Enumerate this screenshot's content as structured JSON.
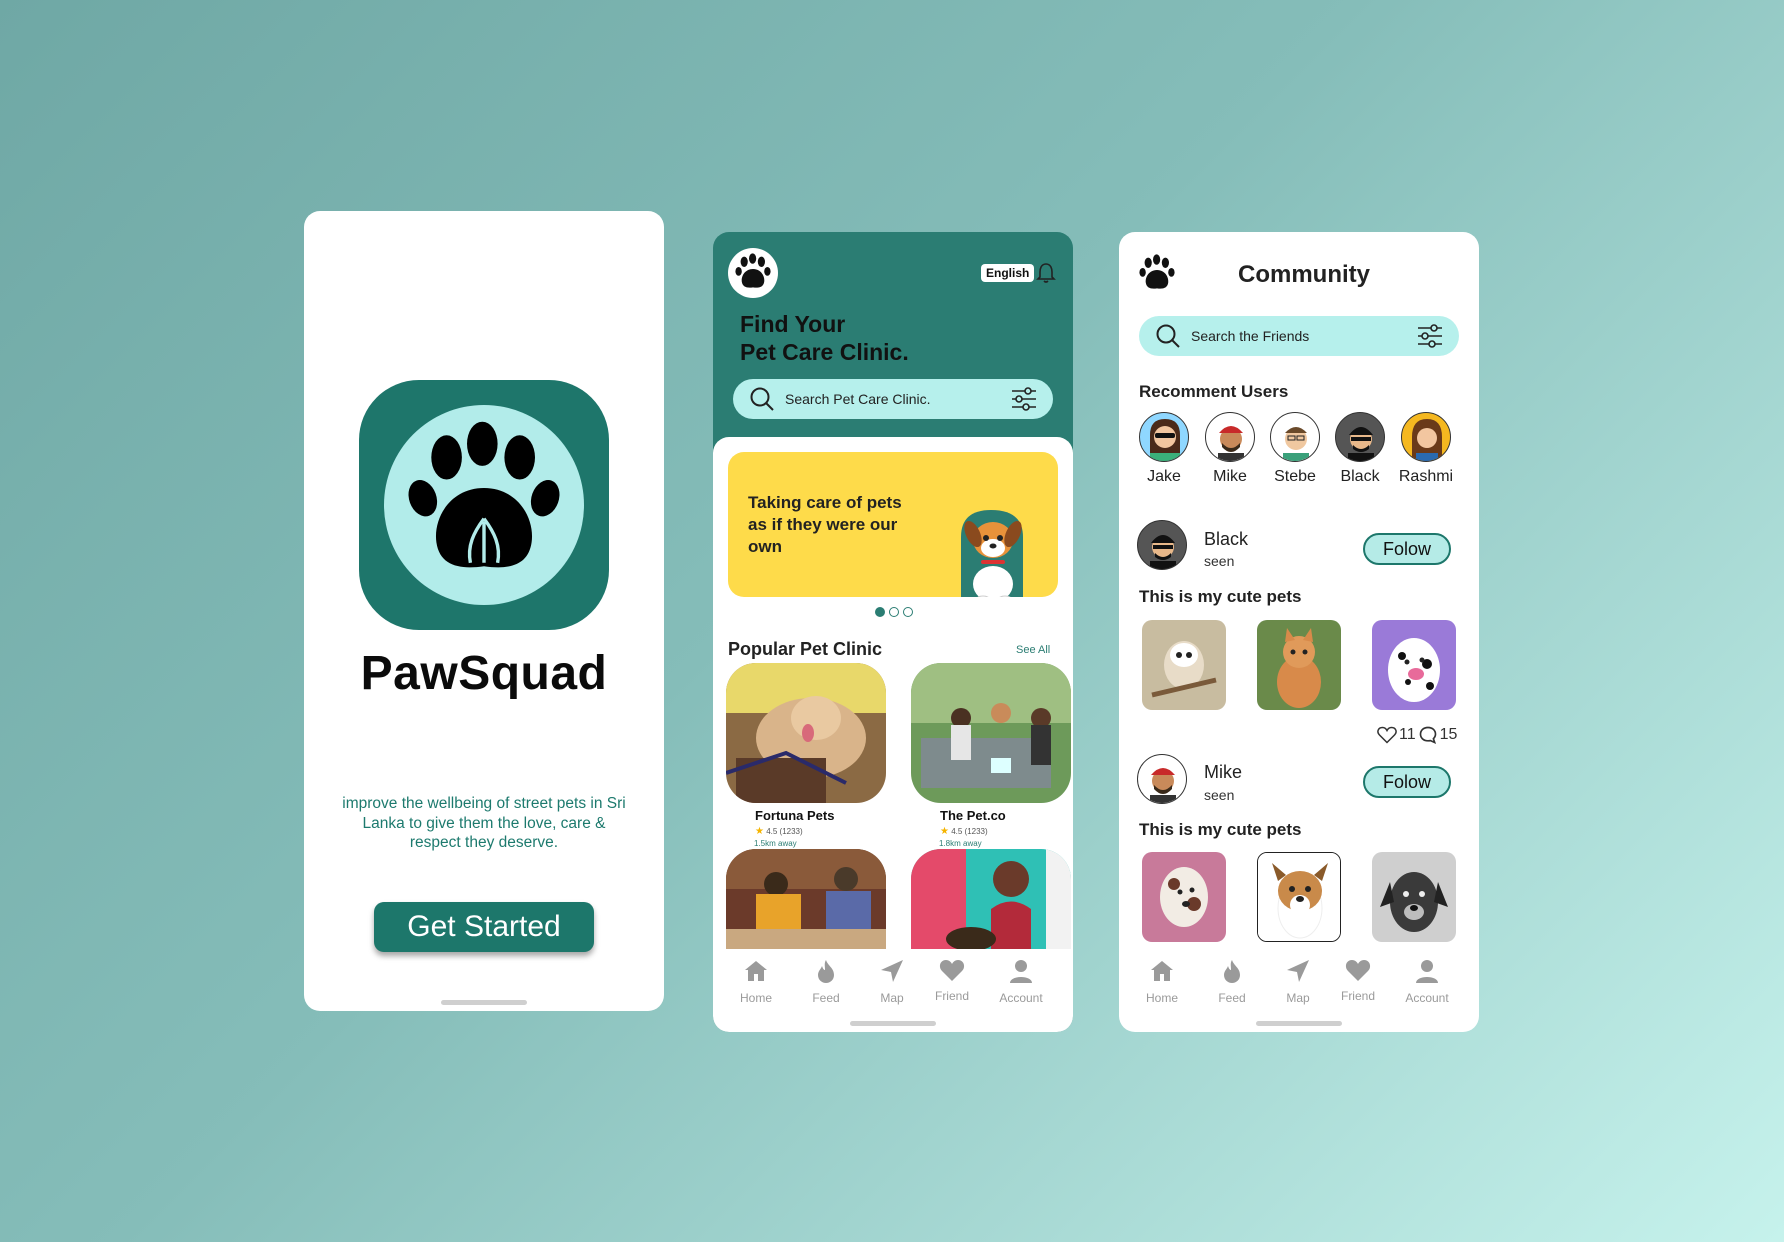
{
  "splash": {
    "app_name": "PawSquad",
    "tagline": "improve the wellbeing of street pets in Sri Lanka to give them the love, care & respect they deserve.",
    "cta_label": "Get Started"
  },
  "clinic": {
    "language": "English",
    "title_line1": "Find Your",
    "title_line2": "Pet Care Clinic.",
    "search_placeholder": "Search Pet Care Clinic.",
    "banner_text": "Taking care of pets as if they were our own",
    "section_title": "Popular Pet Clinic",
    "see_all": "See All",
    "clinics": [
      {
        "name": "Fortuna Pets",
        "rating": "4.5 (1233)",
        "distance": "1.5km away"
      },
      {
        "name": "The Pet.co",
        "rating": "4.5 (1233)",
        "distance": "1.8km away"
      }
    ]
  },
  "nav": {
    "items": [
      {
        "label": "Home",
        "icon": "home-icon"
      },
      {
        "label": "Feed",
        "icon": "fire-icon"
      },
      {
        "label": "Map",
        "icon": "navigation-arrow-icon"
      },
      {
        "label": "Friend",
        "icon": "heart-icon"
      },
      {
        "label": "Account",
        "icon": "user-icon"
      }
    ]
  },
  "community": {
    "title": "Community",
    "search_placeholder": "Search the Friends",
    "recommend_title": "Recomment Users",
    "users": [
      "Jake",
      "Mike",
      "Stebe",
      "Black",
      "Rashmi"
    ],
    "posts": [
      {
        "name": "Black",
        "status": "seen",
        "follow_label": "Folow",
        "caption": "This is my cute pets",
        "likes": "11",
        "comments": "15"
      },
      {
        "name": "Mike",
        "status": "seen",
        "follow_label": "Folow",
        "caption": "This is my cute pets"
      }
    ]
  },
  "colors": {
    "brand_teal": "#1e766b",
    "light_teal": "#b2ecea",
    "banner_yellow": "#fedb4a"
  }
}
